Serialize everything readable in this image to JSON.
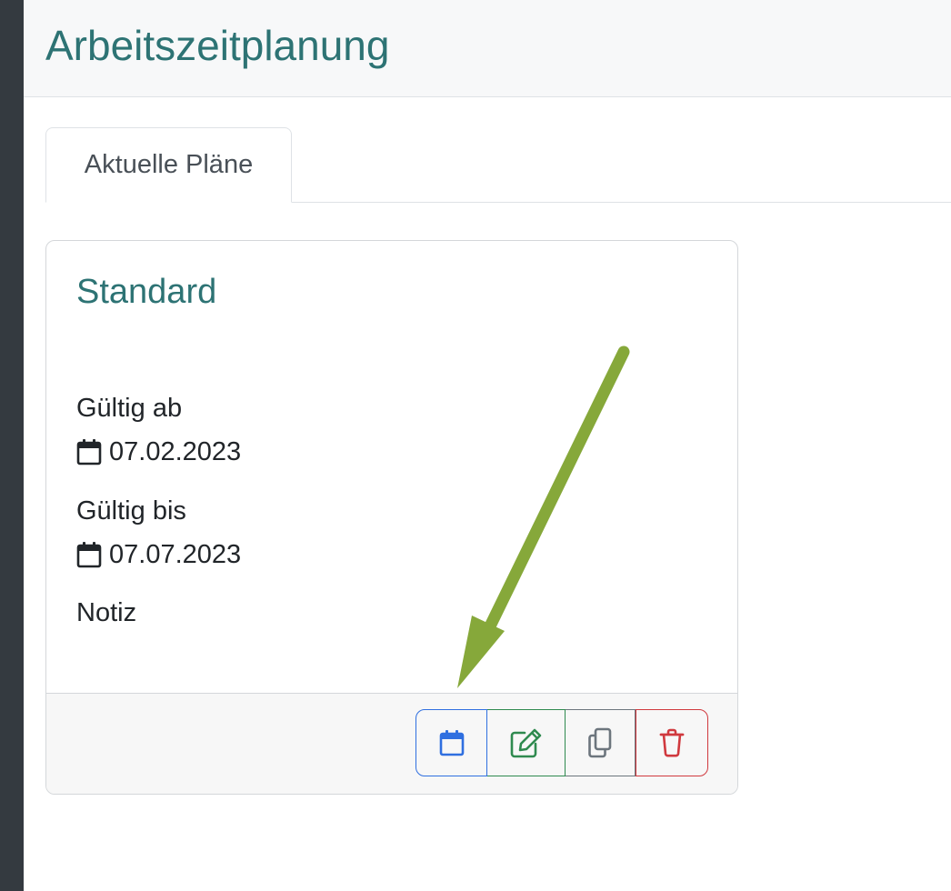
{
  "header": {
    "title": "Arbeitszeitplanung"
  },
  "tabs": [
    {
      "label": "Aktuelle Pläne",
      "active": true
    }
  ],
  "card": {
    "title": "Standard",
    "valid_from_label": "Gültig ab",
    "valid_from_date": "07.02.2023",
    "valid_to_label": "Gültig bis",
    "valid_to_date": "07.07.2023",
    "note_label": "Notiz",
    "actions": [
      {
        "name": "calendar",
        "icon": "calendar-icon",
        "color": "#2f6fe0"
      },
      {
        "name": "edit",
        "icon": "pencil-square-icon",
        "color": "#2f8a4f"
      },
      {
        "name": "copy",
        "icon": "copy-icon",
        "color": "#6c757d"
      },
      {
        "name": "delete",
        "icon": "trash-icon",
        "color": "#d0393e"
      }
    ]
  },
  "annotation": {
    "arrow_color": "#86a83a"
  }
}
